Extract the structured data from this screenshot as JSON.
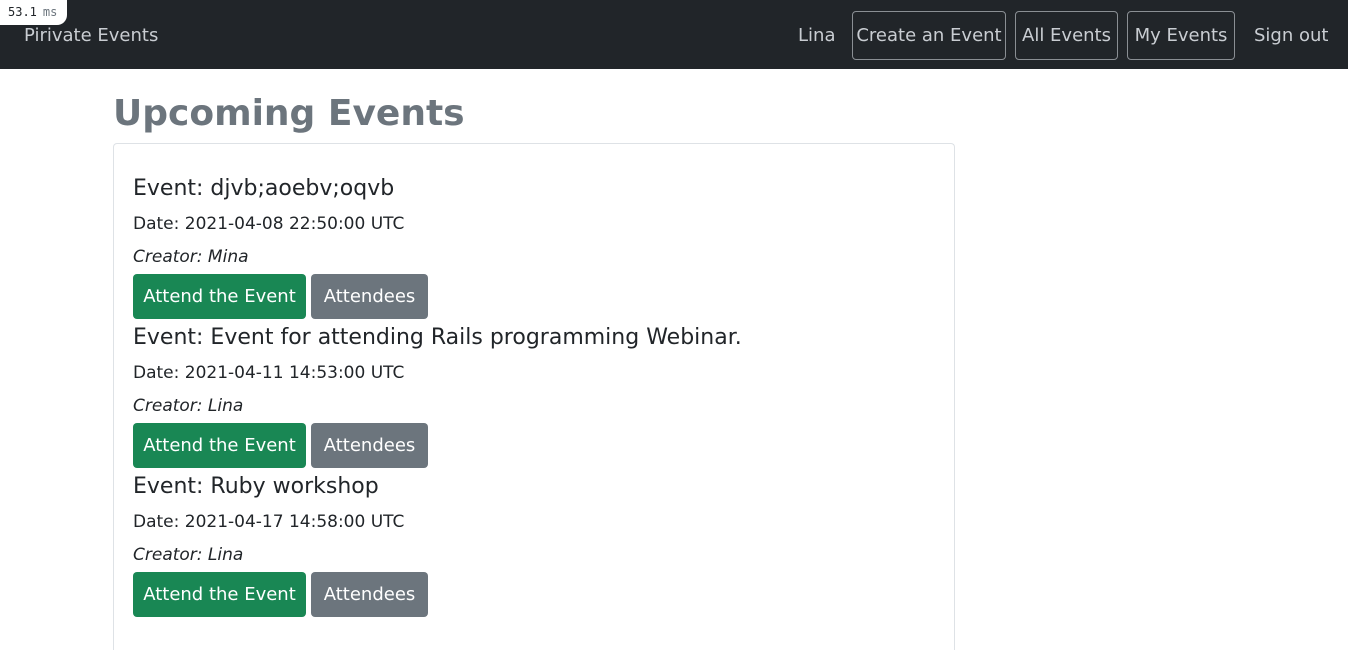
{
  "timer": {
    "value": "53.1",
    "unit": "ms"
  },
  "navbar": {
    "brand": "Pirivate Events",
    "user": "Lina",
    "buttons": [
      "Create an Event",
      "All Events",
      "My Events"
    ],
    "sign_out": "Sign out"
  },
  "page_title": "Upcoming Events",
  "events": [
    {
      "title": "Event: djvb;aoebv;oqvb",
      "date": "Date: 2021-04-08 22:50:00 UTC",
      "creator": "Creator: Mina",
      "attend_label": "Attend the Event",
      "attendees_label": "Attendees"
    },
    {
      "title": "Event: Event for attending Rails programming Webinar.",
      "date": "Date: 2021-04-11 14:53:00 UTC",
      "creator": "Creator: Lina",
      "attend_label": "Attend the Event",
      "attendees_label": "Attendees"
    },
    {
      "title": "Event: Ruby workshop",
      "date": "Date: 2021-04-17 14:58:00 UTC",
      "creator": "Creator: Lina",
      "attend_label": "Attend the Event",
      "attendees_label": "Attendees"
    }
  ],
  "colors": {
    "navbar_bg": "#212529",
    "success": "#198754",
    "secondary": "#6c757d"
  }
}
